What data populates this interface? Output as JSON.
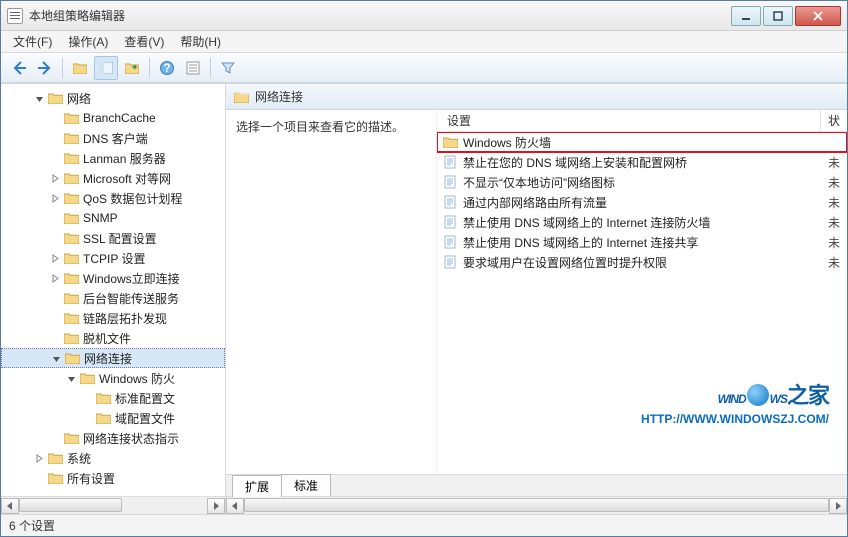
{
  "window": {
    "title": "本地组策略编辑器"
  },
  "menu": {
    "file": "文件(F)",
    "action": "操作(A)",
    "view": "查看(V)",
    "help": "帮助(H)"
  },
  "tree": {
    "items": [
      {
        "indent": 2,
        "label": "网络",
        "expander": "open"
      },
      {
        "indent": 3,
        "label": "BranchCache",
        "expander": "none"
      },
      {
        "indent": 3,
        "label": "DNS 客户端",
        "expander": "none"
      },
      {
        "indent": 3,
        "label": "Lanman 服务器",
        "expander": "none"
      },
      {
        "indent": 3,
        "label": "Microsoft 对等网",
        "expander": "closed"
      },
      {
        "indent": 3,
        "label": "QoS 数据包计划程",
        "expander": "closed"
      },
      {
        "indent": 3,
        "label": "SNMP",
        "expander": "none"
      },
      {
        "indent": 3,
        "label": "SSL 配置设置",
        "expander": "none"
      },
      {
        "indent": 3,
        "label": "TCPIP 设置",
        "expander": "closed"
      },
      {
        "indent": 3,
        "label": "Windows立即连接",
        "expander": "closed"
      },
      {
        "indent": 3,
        "label": "后台智能传送服务",
        "expander": "none"
      },
      {
        "indent": 3,
        "label": "链路层拓扑发现",
        "expander": "none"
      },
      {
        "indent": 3,
        "label": "脱机文件",
        "expander": "none"
      },
      {
        "indent": 3,
        "label": "网络连接",
        "expander": "open",
        "selected": true
      },
      {
        "indent": 4,
        "label": "Windows 防火",
        "expander": "open"
      },
      {
        "indent": 5,
        "label": "标准配置文",
        "expander": "none"
      },
      {
        "indent": 5,
        "label": "域配置文件",
        "expander": "none"
      },
      {
        "indent": 3,
        "label": "网络连接状态指示",
        "expander": "none"
      },
      {
        "indent": 2,
        "label": "系统",
        "expander": "closed"
      },
      {
        "indent": 2,
        "label": "所有设置",
        "expander": "none"
      }
    ]
  },
  "list": {
    "header_title": "网络连接",
    "desc_prompt": "选择一个项目来查看它的描述。",
    "col_setting": "设置",
    "col_status": "状",
    "rows": [
      {
        "type": "folder",
        "name": "Windows 防火墙",
        "status": "",
        "highlight": true
      },
      {
        "type": "policy",
        "name": "禁止在您的 DNS 域网络上安装和配置网桥",
        "status": "未"
      },
      {
        "type": "policy",
        "name": "不显示“仅本地访问”网络图标",
        "status": "未"
      },
      {
        "type": "policy",
        "name": "通过内部网络路由所有流量",
        "status": "未"
      },
      {
        "type": "policy",
        "name": "禁止使用 DNS 域网络上的 Internet 连接防火墙",
        "status": "未"
      },
      {
        "type": "policy",
        "name": "禁止使用 DNS 域网络上的 Internet 连接共享",
        "status": "未"
      },
      {
        "type": "policy",
        "name": "要求域用户在设置网络位置时提升权限",
        "status": "未"
      }
    ],
    "tabs": {
      "extended": "扩展",
      "standard": "标准"
    }
  },
  "watermark": {
    "brand_pre": "WIND",
    "brand_post": "WS",
    "brand_cn": "之家",
    "url": "HTTP://WWW.WINDOWSZJ.COM/"
  },
  "status": {
    "text": "6 个设置"
  }
}
